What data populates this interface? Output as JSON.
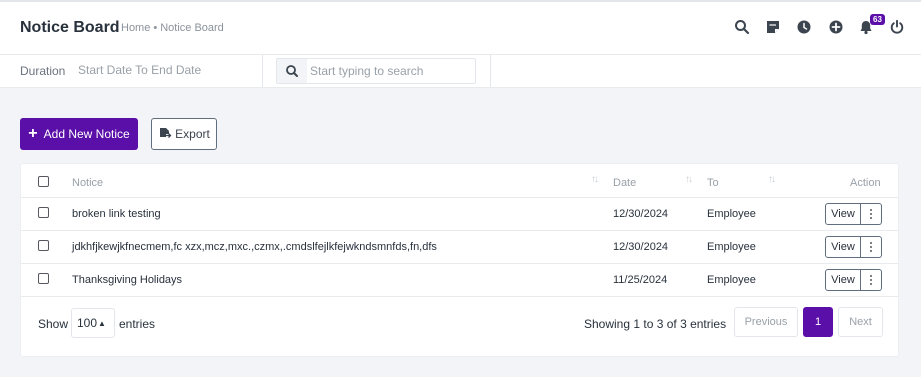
{
  "header": {
    "title": "Notice Board",
    "breadcrumb": {
      "home": "Home",
      "separator": "•",
      "current": "Notice Board"
    },
    "icons": [
      "search-icon",
      "sticky-note-icon",
      "clock-icon",
      "plus-circle-icon",
      "bell-icon",
      "power-icon"
    ],
    "notification_count": "63"
  },
  "filters": {
    "duration_label": "Duration",
    "duration_value": "Start Date To End Date",
    "search_placeholder": "Start typing to search"
  },
  "actions": {
    "add_label": "Add New Notice",
    "export_label": "Export"
  },
  "table": {
    "columns": {
      "notice": "Notice",
      "date": "Date",
      "to": "To",
      "action": "Action"
    },
    "sort_glyph": "↑↓",
    "view_label": "View",
    "rows": [
      {
        "notice": "broken link testing",
        "date": "12/30/2024",
        "to": "Employee"
      },
      {
        "notice": "jdkhfjkewjkfnecmem,fc xzx,mcz,mxc.,czmx,.cmdslfejlkfejwkndsmnfds,fn,dfs",
        "date": "12/30/2024",
        "to": "Employee"
      },
      {
        "notice": "Thanksgiving Holidays",
        "date": "11/25/2024",
        "to": "Employee"
      }
    ]
  },
  "footer": {
    "show_label": "Show",
    "entries_value": "100",
    "entries_label": "entries",
    "showing_text": "Showing 1 to 3 of 3 entries",
    "previous_label": "Previous",
    "current_page": "1",
    "next_label": "Next"
  },
  "colors": {
    "accent": "#5a0fa8",
    "text": "#28313c",
    "muted": "#99a0a8",
    "background": "#f2f4f7"
  }
}
